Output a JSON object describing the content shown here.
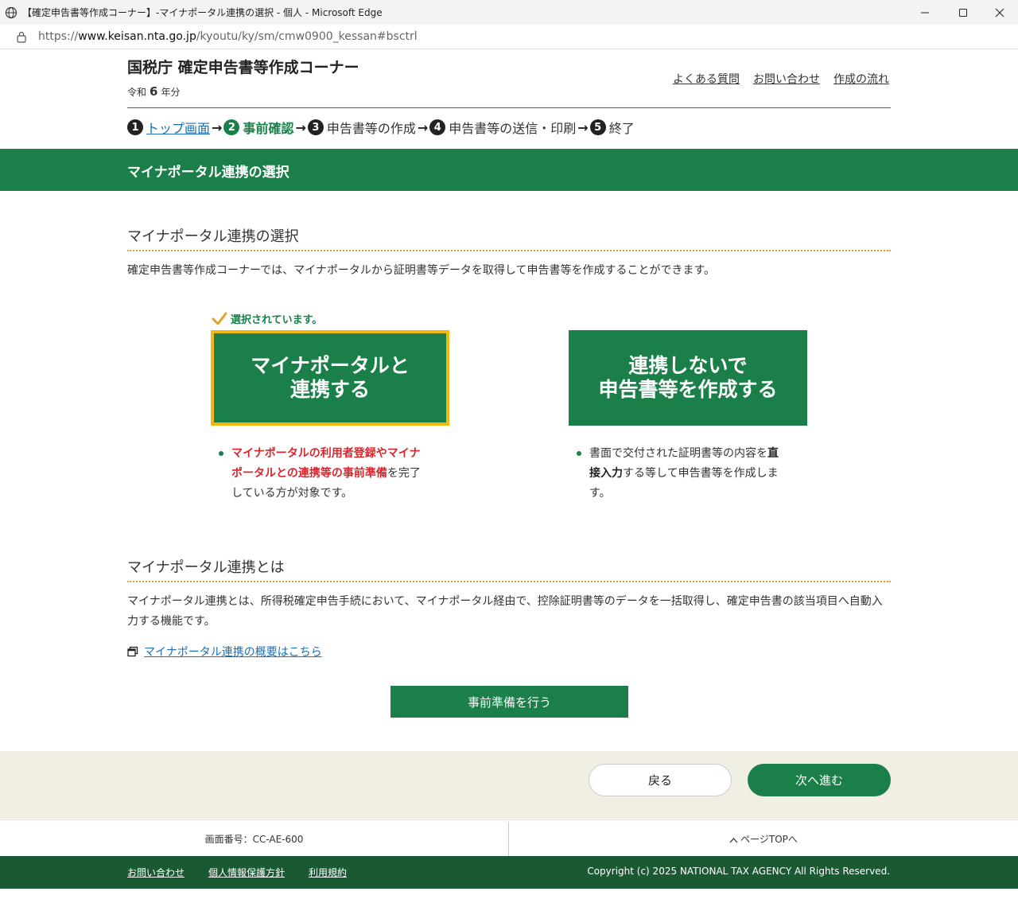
{
  "window": {
    "title": "【確定申告書等作成コーナー】-マイナポータル連携の選択 - 個人 - Microsoft Edge",
    "url_prefix": "https://",
    "url_host": "www.keisan.nta.go.jp",
    "url_path": "/kyoutu/ky/sm/cmw0900_kessan#bsctrl"
  },
  "header": {
    "site_title": "国税庁 確定申告書等作成コーナー",
    "era_prefix": "令和",
    "era_year": "6",
    "era_suffix": "年分",
    "links": [
      "よくある質問",
      "お問い合わせ",
      "作成の流れ"
    ]
  },
  "steps": [
    {
      "num": "1",
      "label": "トップ画面"
    },
    {
      "num": "2",
      "label": "事前確認"
    },
    {
      "num": "3",
      "label": "申告書等の作成"
    },
    {
      "num": "4",
      "label": "申告書等の送信・印刷"
    },
    {
      "num": "5",
      "label": "終了"
    }
  ],
  "banner_title": "マイナポータル連携の選択",
  "section1": {
    "heading": "マイナポータル連携の選択",
    "description": "確定申告書等作成コーナーでは、マイナポータルから証明書等データを取得して申告書等を作成することができます。",
    "selected_note": "選択されています。",
    "option_link_line1": "マイナポータルと",
    "option_link_line2": "連携する",
    "option_nolink_line1": "連携しないで",
    "option_nolink_line2": "申告書等を作成する",
    "bullet_left_red1": "マイナポータルの利用者登録やマイナ",
    "bullet_left_red2": "ポータルとの連携等の事前準備",
    "bullet_left_rest1": "を完了",
    "bullet_left_rest2": "している方が対象です。",
    "bullet_right_1": "書面で交付された証明書等の内容を",
    "bullet_right_bold1": "直",
    "bullet_right_bold2": "接入力",
    "bullet_right_2": "する等して申告書等を作成しま",
    "bullet_right_3": "す。"
  },
  "section2": {
    "heading": "マイナポータル連携とは",
    "description": "マイナポータル連携とは、所得税確定申告手続において、マイナポータル経由で、控除証明書等のデータを一括取得し、確定申告書の該当項目へ自動入力する機能です。",
    "overview_link": "マイナポータル連携の概要はこちら",
    "prep_button": "事前準備を行う"
  },
  "nav": {
    "back": "戻る",
    "next": "次へ進む"
  },
  "info": {
    "screen_number": "画面番号：CC-AE-600",
    "page_top": "ページTOPへ"
  },
  "footer": {
    "links": [
      "お問い合わせ",
      "個人情報保護方針",
      "利用規約"
    ],
    "copyright": "Copyright (c) 2025 NATIONAL TAX AGENCY All Rights Reserved."
  },
  "colors": {
    "brand_green": "#1b7f49",
    "footer_green": "#1a5a33",
    "selection_yellow": "#f2b90c",
    "emphasis_red": "#d7262e",
    "link_blue": "#1a6fb5"
  }
}
